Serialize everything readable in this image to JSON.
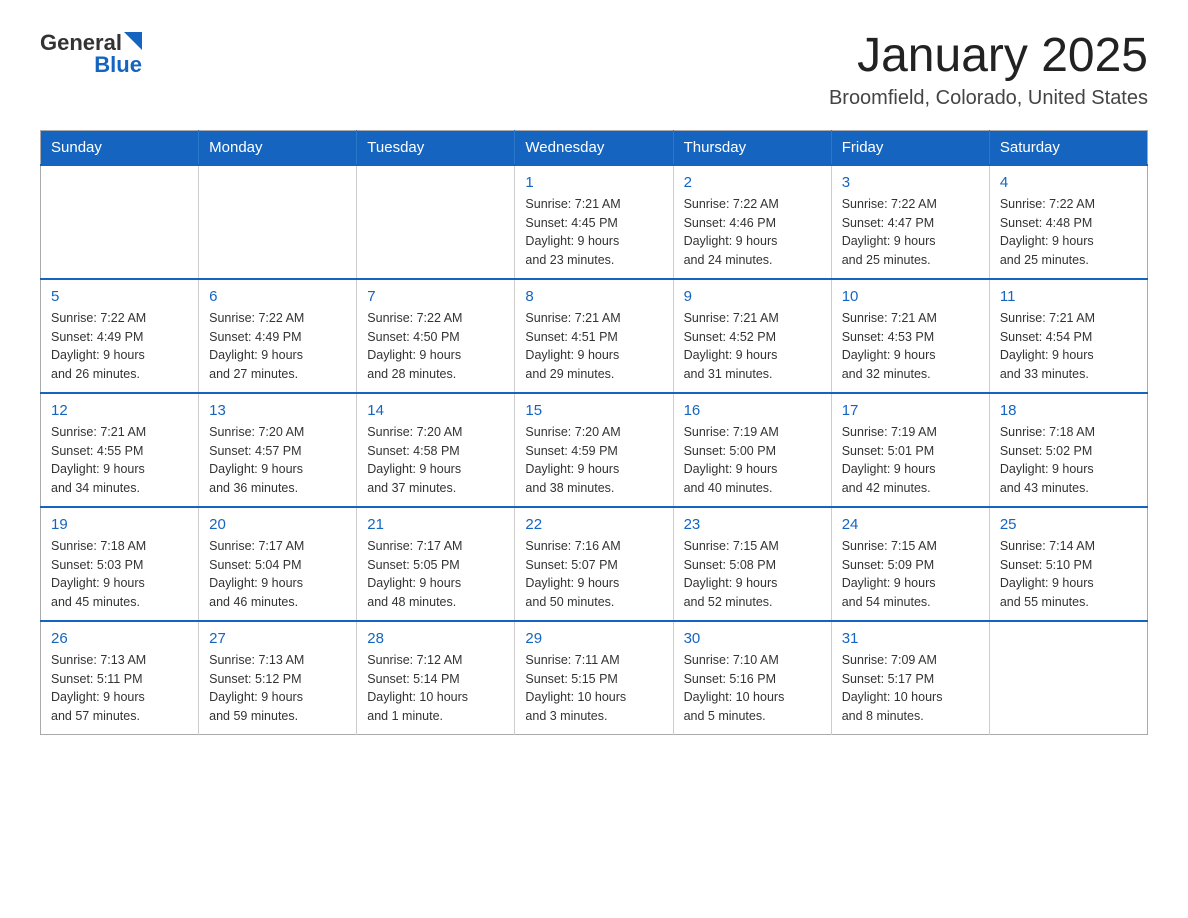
{
  "header": {
    "logo_general": "General",
    "logo_blue": "Blue",
    "title": "January 2025",
    "subtitle": "Broomfield, Colorado, United States"
  },
  "days_of_week": [
    "Sunday",
    "Monday",
    "Tuesday",
    "Wednesday",
    "Thursday",
    "Friday",
    "Saturday"
  ],
  "weeks": [
    [
      {
        "day": "",
        "info": ""
      },
      {
        "day": "",
        "info": ""
      },
      {
        "day": "",
        "info": ""
      },
      {
        "day": "1",
        "info": "Sunrise: 7:21 AM\nSunset: 4:45 PM\nDaylight: 9 hours\nand 23 minutes."
      },
      {
        "day": "2",
        "info": "Sunrise: 7:22 AM\nSunset: 4:46 PM\nDaylight: 9 hours\nand 24 minutes."
      },
      {
        "day": "3",
        "info": "Sunrise: 7:22 AM\nSunset: 4:47 PM\nDaylight: 9 hours\nand 25 minutes."
      },
      {
        "day": "4",
        "info": "Sunrise: 7:22 AM\nSunset: 4:48 PM\nDaylight: 9 hours\nand 25 minutes."
      }
    ],
    [
      {
        "day": "5",
        "info": "Sunrise: 7:22 AM\nSunset: 4:49 PM\nDaylight: 9 hours\nand 26 minutes."
      },
      {
        "day": "6",
        "info": "Sunrise: 7:22 AM\nSunset: 4:49 PM\nDaylight: 9 hours\nand 27 minutes."
      },
      {
        "day": "7",
        "info": "Sunrise: 7:22 AM\nSunset: 4:50 PM\nDaylight: 9 hours\nand 28 minutes."
      },
      {
        "day": "8",
        "info": "Sunrise: 7:21 AM\nSunset: 4:51 PM\nDaylight: 9 hours\nand 29 minutes."
      },
      {
        "day": "9",
        "info": "Sunrise: 7:21 AM\nSunset: 4:52 PM\nDaylight: 9 hours\nand 31 minutes."
      },
      {
        "day": "10",
        "info": "Sunrise: 7:21 AM\nSunset: 4:53 PM\nDaylight: 9 hours\nand 32 minutes."
      },
      {
        "day": "11",
        "info": "Sunrise: 7:21 AM\nSunset: 4:54 PM\nDaylight: 9 hours\nand 33 minutes."
      }
    ],
    [
      {
        "day": "12",
        "info": "Sunrise: 7:21 AM\nSunset: 4:55 PM\nDaylight: 9 hours\nand 34 minutes."
      },
      {
        "day": "13",
        "info": "Sunrise: 7:20 AM\nSunset: 4:57 PM\nDaylight: 9 hours\nand 36 minutes."
      },
      {
        "day": "14",
        "info": "Sunrise: 7:20 AM\nSunset: 4:58 PM\nDaylight: 9 hours\nand 37 minutes."
      },
      {
        "day": "15",
        "info": "Sunrise: 7:20 AM\nSunset: 4:59 PM\nDaylight: 9 hours\nand 38 minutes."
      },
      {
        "day": "16",
        "info": "Sunrise: 7:19 AM\nSunset: 5:00 PM\nDaylight: 9 hours\nand 40 minutes."
      },
      {
        "day": "17",
        "info": "Sunrise: 7:19 AM\nSunset: 5:01 PM\nDaylight: 9 hours\nand 42 minutes."
      },
      {
        "day": "18",
        "info": "Sunrise: 7:18 AM\nSunset: 5:02 PM\nDaylight: 9 hours\nand 43 minutes."
      }
    ],
    [
      {
        "day": "19",
        "info": "Sunrise: 7:18 AM\nSunset: 5:03 PM\nDaylight: 9 hours\nand 45 minutes."
      },
      {
        "day": "20",
        "info": "Sunrise: 7:17 AM\nSunset: 5:04 PM\nDaylight: 9 hours\nand 46 minutes."
      },
      {
        "day": "21",
        "info": "Sunrise: 7:17 AM\nSunset: 5:05 PM\nDaylight: 9 hours\nand 48 minutes."
      },
      {
        "day": "22",
        "info": "Sunrise: 7:16 AM\nSunset: 5:07 PM\nDaylight: 9 hours\nand 50 minutes."
      },
      {
        "day": "23",
        "info": "Sunrise: 7:15 AM\nSunset: 5:08 PM\nDaylight: 9 hours\nand 52 minutes."
      },
      {
        "day": "24",
        "info": "Sunrise: 7:15 AM\nSunset: 5:09 PM\nDaylight: 9 hours\nand 54 minutes."
      },
      {
        "day": "25",
        "info": "Sunrise: 7:14 AM\nSunset: 5:10 PM\nDaylight: 9 hours\nand 55 minutes."
      }
    ],
    [
      {
        "day": "26",
        "info": "Sunrise: 7:13 AM\nSunset: 5:11 PM\nDaylight: 9 hours\nand 57 minutes."
      },
      {
        "day": "27",
        "info": "Sunrise: 7:13 AM\nSunset: 5:12 PM\nDaylight: 9 hours\nand 59 minutes."
      },
      {
        "day": "28",
        "info": "Sunrise: 7:12 AM\nSunset: 5:14 PM\nDaylight: 10 hours\nand 1 minute."
      },
      {
        "day": "29",
        "info": "Sunrise: 7:11 AM\nSunset: 5:15 PM\nDaylight: 10 hours\nand 3 minutes."
      },
      {
        "day": "30",
        "info": "Sunrise: 7:10 AM\nSunset: 5:16 PM\nDaylight: 10 hours\nand 5 minutes."
      },
      {
        "day": "31",
        "info": "Sunrise: 7:09 AM\nSunset: 5:17 PM\nDaylight: 10 hours\nand 8 minutes."
      },
      {
        "day": "",
        "info": ""
      }
    ]
  ]
}
